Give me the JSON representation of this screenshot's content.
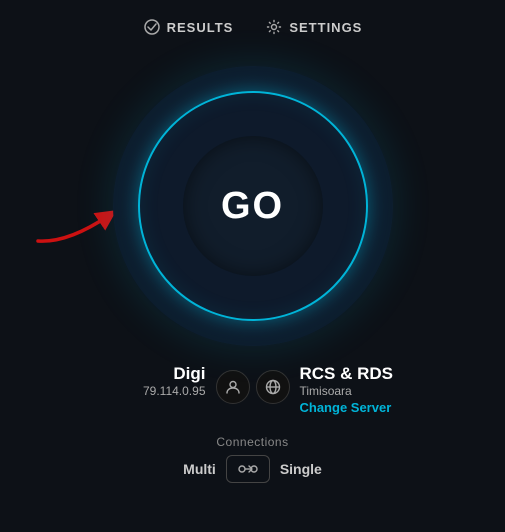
{
  "header": {
    "results_label": "RESULTS",
    "settings_label": "SETTINGS"
  },
  "go_button": {
    "label": "GO"
  },
  "info": {
    "left": {
      "name": "Digi",
      "ip": "79.114.0.95"
    },
    "right": {
      "name": "RCS & RDS",
      "location": "Timisoara",
      "change_server": "Change Server"
    }
  },
  "connections": {
    "label": "Connections",
    "multi": "Multi",
    "single": "Single"
  },
  "colors": {
    "teal": "#00b4d8",
    "bg": "#0d1117",
    "red_arrow": "#cc1111"
  }
}
